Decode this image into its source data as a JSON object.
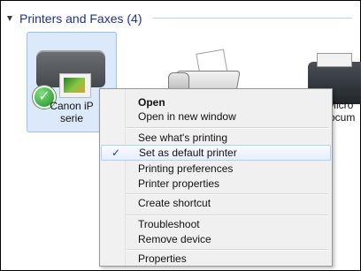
{
  "group": {
    "title": "Printers and Faxes (4)"
  },
  "devices": [
    {
      "label_line1": "Canon iP",
      "label_line2": "serie",
      "selected": true,
      "default": true,
      "icon": "printer-icon"
    },
    {
      "label_line1": "",
      "label_line2": "",
      "selected": false,
      "icon": "fax-icon"
    },
    {
      "label_line1": "Micro",
      "label_line2": "ocum",
      "selected": false,
      "icon": "document-writer-icon"
    }
  ],
  "context_menu": {
    "items": [
      {
        "label": "Open",
        "bold": true
      },
      {
        "label": "Open in new window"
      },
      {
        "label": "See what's printing"
      },
      {
        "label": "Set as default printer",
        "checked": true,
        "hover": true
      },
      {
        "label": "Printing preferences"
      },
      {
        "label": "Printer properties"
      },
      {
        "label": "Create shortcut"
      },
      {
        "label": "Troubleshoot"
      },
      {
        "label": "Remove device"
      },
      {
        "label": "Properties"
      }
    ]
  },
  "colors": {
    "header_text": "#1e3287",
    "selection_fill": "#dbe9fb",
    "selection_border": "#9cc1f0",
    "menu_bg": "#f0f0f0",
    "menu_hover_border": "#aecff7",
    "check_green": "#1f8f1f"
  }
}
